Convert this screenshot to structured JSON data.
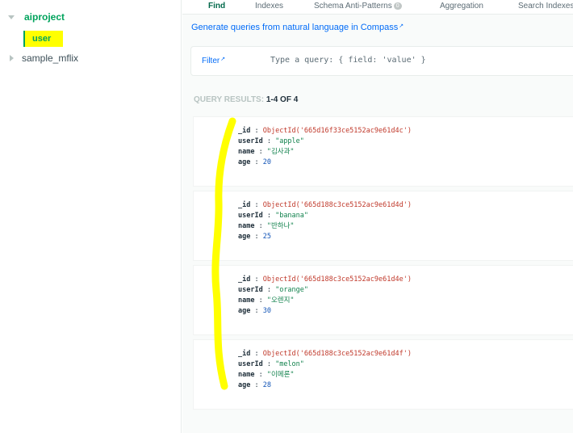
{
  "sidebar": {
    "databases": [
      {
        "name": "aiproject",
        "expanded": true,
        "collections": [
          {
            "name": "user",
            "selected": true
          }
        ]
      },
      {
        "name": "sample_mflix",
        "expanded": false
      }
    ]
  },
  "tabs": [
    {
      "label": "Find",
      "active": true
    },
    {
      "label": "Indexes"
    },
    {
      "label": "Schema Anti-Patterns",
      "badge": "0"
    },
    {
      "label": "Aggregation"
    },
    {
      "label": "Search Indexes"
    }
  ],
  "generate_link": "Generate queries from natural language in Compass",
  "query": {
    "filter_label": "Filter",
    "placeholder": "Type a query: { field: 'value' }"
  },
  "results": {
    "label": "QUERY RESULTS:",
    "count": "1-4 OF 4"
  },
  "documents": [
    {
      "id": "ObjectId('665d16f33ce5152ac9e61d4c')",
      "userId": "\"apple\"",
      "name": "\"김사과\"",
      "age": "20"
    },
    {
      "id": "ObjectId('665d188c3ce5152ac9e61d4d')",
      "userId": "\"banana\"",
      "name": "\"반하나\"",
      "age": "25"
    },
    {
      "id": "ObjectId('665d188c3ce5152ac9e61d4e')",
      "userId": "\"orange\"",
      "name": "\"오렌지\"",
      "age": "30"
    },
    {
      "id": "ObjectId('665d188c3ce5152ac9e61d4f')",
      "userId": "\"melon\"",
      "name": "\"이메론\"",
      "age": "28"
    }
  ],
  "field_keys": {
    "id": "_id",
    "userId": "userId",
    "name": "name",
    "age": "age",
    "separator": " : "
  },
  "colors": {
    "brand_green": "#00a35c",
    "link_blue": "#016bf8",
    "highlight_yellow": "#ffff00",
    "objectid_red": "#c0392b",
    "string_green": "#12824d",
    "number_blue": "#1254b7"
  }
}
